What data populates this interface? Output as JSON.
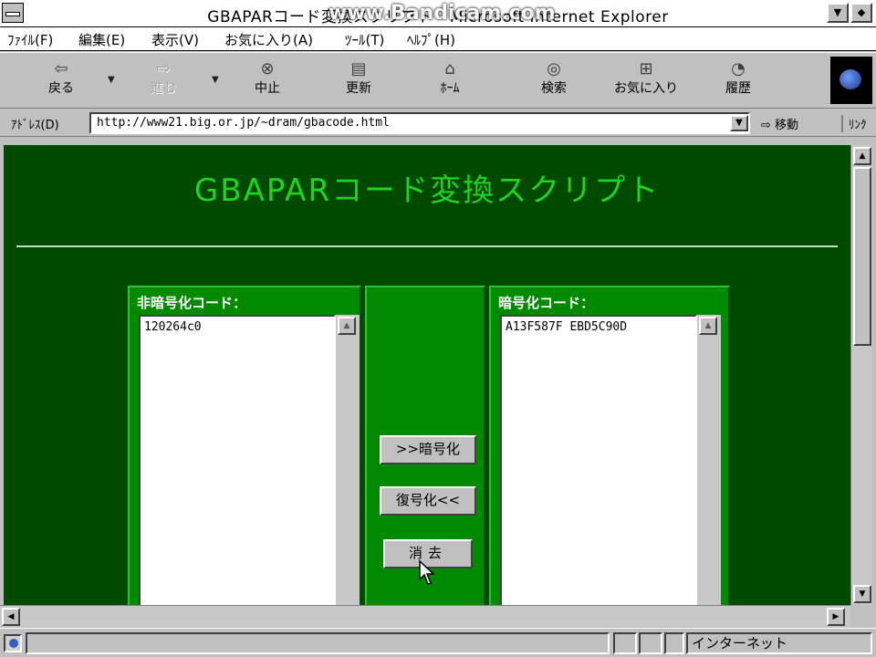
{
  "window": {
    "title": "GBAPARコード変換スクリプト - Microsoft Internet Explorer",
    "watermark": "www.Bandicam.com"
  },
  "menu": [
    "ﾌｧｲﾙ(F)",
    "編集(E)",
    "表示(V)",
    "お気に入り(A)",
    "ﾂｰﾙ(T)",
    "ﾍﾙﾌﾟ(H)"
  ],
  "toolbar": {
    "back": "戻る",
    "forward": "進む",
    "stop": "中止",
    "refresh": "更新",
    "home": "ﾎｰﾑ",
    "search": "検索",
    "favorites": "お気に入り",
    "history": "履歴"
  },
  "address": {
    "label": "ｱﾄﾞﾚｽ(D)",
    "url": "http://www21.big.or.jp/~dram/gbacode.html",
    "go": "移動",
    "links": "ﾘﾝｸ"
  },
  "page": {
    "heading": "GBAPARコード変換スクリプト",
    "plain_label": "非暗号化コード：",
    "plain_value": "120264c0",
    "encrypted_label": "暗号化コード：",
    "encrypted_value": "A13F587F EBD5C90D",
    "encrypt_button": ">>暗号化",
    "decrypt_button": "復号化<<",
    "clear_button": "消去"
  },
  "status": {
    "zone": "インターネット"
  }
}
